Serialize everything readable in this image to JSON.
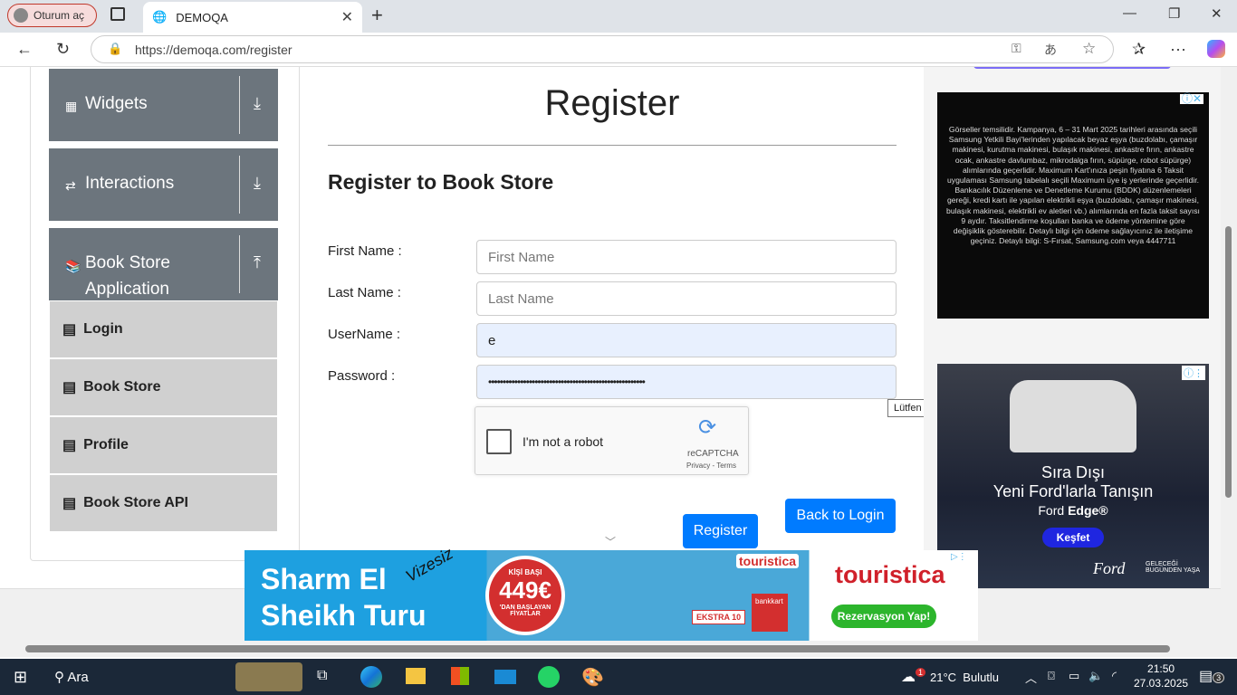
{
  "browser": {
    "profile_label": "Oturum aç",
    "tab_title": "DEMOQA",
    "url": "https://demoqa.com/register"
  },
  "sidebar": {
    "groups": [
      {
        "label": "Widgets",
        "icon": "grid-icon",
        "expanded": false
      },
      {
        "label": "Interactions",
        "icon": "swap-icon",
        "expanded": false
      },
      {
        "label": "Book Store Application",
        "icon": "books-icon",
        "expanded": true
      }
    ],
    "items": [
      {
        "label": "Login"
      },
      {
        "label": "Book Store"
      },
      {
        "label": "Profile"
      },
      {
        "label": "Book Store API"
      }
    ]
  },
  "form": {
    "title": "Register",
    "subtitle": "Register to Book Store",
    "fields": [
      {
        "label": "First Name :",
        "placeholder": "First Name",
        "value": ""
      },
      {
        "label": "Last Name :",
        "placeholder": "Last Name",
        "value": ""
      },
      {
        "label": "UserName :",
        "placeholder": "",
        "value": "e"
      },
      {
        "label": "Password :",
        "placeholder": "",
        "value": "••••••••••••••••••••••••••••••••••••••••••••••••••••••"
      }
    ],
    "captcha_label": "I'm not a robot",
    "captcha_brand": "reCAPTCHA",
    "captcha_links": "Privacy - Terms",
    "tooltip": "Lütfen istenen biçimle eşleştirin.",
    "register_button": "Register",
    "back_button": "Back to Login"
  },
  "ads": {
    "samsung_text": "Görseller temsilidir. Kampanya, 6 – 31 Mart 2025 tarihleri arasında seçili Samsung Yetkili Bayi'lerinden yapılacak beyaz eşya (buzdolabı, çamaşır makinesi, kurutma makinesi, bulaşık makinesi, ankastre fırın, ankastre ocak, ankastre davlumbaz, mikrodalga fırın, süpürge, robot süpürge) alımlarında geçerlidir. Maximum Kart'ınıza peşin fiyatına 6 Taksit uygulaması Samsung tabelalı seçili Maximum üye iş yerlerinde geçerlidir. Bankacılık Düzenleme ve Denetleme Kurumu (BDDK) düzenlemeleri gereği, kredi kartı ile yapılan elektrikli eşya (buzdolabı, çamaşır makinesi, bulaşık makinesi, elektrikli ev aletleri vb.) alımlarında en fazla taksit sayısı 9 aydır. Taksitlendirme koşulları banka ve ödeme yöntemine göre değişiklik gösterebilir. Detaylı bilgi için ödeme sağlayıcınız ile iletişime geçiniz. Detaylı bilgi: S-Fırsat, Samsung.com veya 4447711",
    "ford_line1": "Sıra Dışı",
    "ford_line2": "Yeni Ford'larla Tanışın",
    "ford_model": "Ford",
    "ford_model_bold": "Edge®",
    "ford_cta": "Keşfet",
    "ford_brand": "Ford",
    "ford_slogan": "GELECEĞİ BUGÜNDEN YAŞA",
    "tour_line1": "Sharm El",
    "tour_line2": "Sheikh Turu",
    "tour_tag": "Vizesiz",
    "tour_price_top": "KİŞİ BAŞI",
    "tour_price": "449€",
    "tour_price_bottom": "'DAN BAŞLAYAN FİYATLAR",
    "tour_badge": "EKSTRA 10",
    "tour_bank": "bankkart",
    "tour_brand": "touristica",
    "tour_cta": "Rezervasyon Yap!"
  },
  "taskbar": {
    "search": "Ara",
    "weather_temp": "21°C",
    "weather_text": "Bulutlu",
    "weather_badge": "1",
    "time": "21:50",
    "date": "27.03.2025",
    "notif_count": "3"
  }
}
